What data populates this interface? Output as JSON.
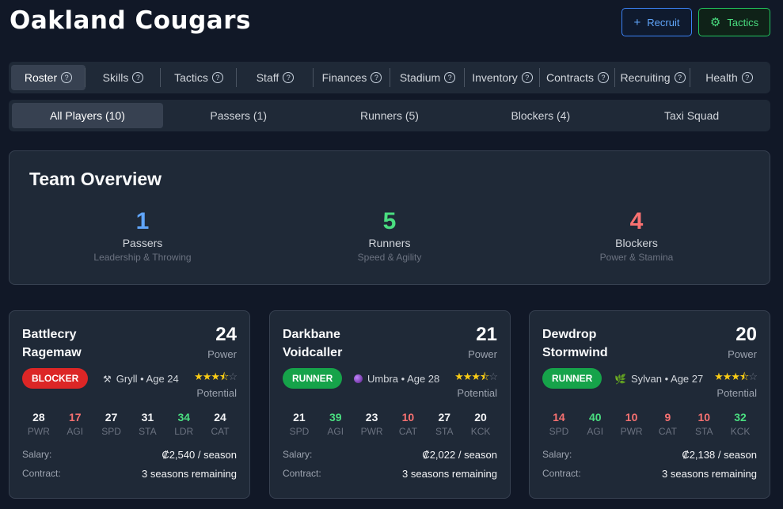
{
  "app": {
    "title": "Oakland Cougars"
  },
  "header": {
    "recruit_label": "Recruit",
    "tactics_label": "Tactics"
  },
  "tabs": [
    {
      "label": "Roster"
    },
    {
      "label": "Skills"
    },
    {
      "label": "Tactics"
    },
    {
      "label": "Staff"
    },
    {
      "label": "Finances"
    },
    {
      "label": "Stadium"
    },
    {
      "label": "Inventory"
    },
    {
      "label": "Contracts"
    },
    {
      "label": "Recruiting"
    },
    {
      "label": "Health"
    }
  ],
  "subtabs": [
    {
      "label": "All Players (10)"
    },
    {
      "label": "Passers (1)"
    },
    {
      "label": "Runners (5)"
    },
    {
      "label": "Blockers (4)"
    },
    {
      "label": "Taxi Squad"
    }
  ],
  "overview": {
    "title": "Team Overview",
    "passers": {
      "count": "1",
      "label": "Passers",
      "sub": "Leadership & Throwing",
      "color": "#60a5fa"
    },
    "runners": {
      "count": "5",
      "label": "Runners",
      "sub": "Speed & Agility",
      "color": "#4ade80"
    },
    "blockers": {
      "count": "4",
      "label": "Blockers",
      "sub": "Power & Stamina",
      "color": "#f87171"
    }
  },
  "power_label": "Power",
  "potential_label": "Potential",
  "salary_label": "Salary:",
  "contract_label": "Contract:",
  "players": [
    {
      "name_line1": "Battlecry",
      "name_line2": "Ragemaw",
      "power": "24",
      "role": "BLOCKER",
      "race_icon": "crossed-hammers-icon",
      "race_text": "Gryll • Age 24",
      "stars": {
        "full": 3,
        "half": 1,
        "empty": 1
      },
      "stats": [
        {
          "value": "28",
          "label": "PWR",
          "color": "#f3f4f6"
        },
        {
          "value": "17",
          "label": "AGI",
          "color": "#f87171"
        },
        {
          "value": "27",
          "label": "SPD",
          "color": "#f3f4f6"
        },
        {
          "value": "31",
          "label": "STA",
          "color": "#f3f4f6"
        },
        {
          "value": "34",
          "label": "LDR",
          "color": "#4ade80"
        },
        {
          "value": "24",
          "label": "CAT",
          "color": "#f3f4f6"
        }
      ],
      "salary": "₡2,540 / season",
      "contract": "3 seasons remaining"
    },
    {
      "name_line1": "Darkbane",
      "name_line2": "Voidcaller",
      "power": "21",
      "role": "RUNNER",
      "race_icon": "purple-orb-icon",
      "race_text": "Umbra • Age 28",
      "stars": {
        "full": 3,
        "half": 1,
        "empty": 1
      },
      "stats": [
        {
          "value": "21",
          "label": "SPD",
          "color": "#f3f4f6"
        },
        {
          "value": "39",
          "label": "AGI",
          "color": "#4ade80"
        },
        {
          "value": "23",
          "label": "PWR",
          "color": "#f3f4f6"
        },
        {
          "value": "10",
          "label": "CAT",
          "color": "#f87171"
        },
        {
          "value": "27",
          "label": "STA",
          "color": "#f3f4f6"
        },
        {
          "value": "20",
          "label": "KCK",
          "color": "#f3f4f6"
        }
      ],
      "salary": "₡2,022 / season",
      "contract": "3 seasons remaining"
    },
    {
      "name_line1": "Dewdrop",
      "name_line2": "Stormwind",
      "power": "20",
      "role": "RUNNER",
      "race_icon": "leaf-icon",
      "race_text": "Sylvan • Age 27",
      "stars": {
        "full": 3,
        "half": 1,
        "empty": 1
      },
      "stats": [
        {
          "value": "14",
          "label": "SPD",
          "color": "#f87171"
        },
        {
          "value": "40",
          "label": "AGI",
          "color": "#4ade80"
        },
        {
          "value": "10",
          "label": "PWR",
          "color": "#f87171"
        },
        {
          "value": "9",
          "label": "CAT",
          "color": "#f87171"
        },
        {
          "value": "10",
          "label": "STA",
          "color": "#f87171"
        },
        {
          "value": "32",
          "label": "KCK",
          "color": "#4ade80"
        }
      ],
      "salary": "₡2,138 / season",
      "contract": "3 seasons remaining"
    }
  ]
}
